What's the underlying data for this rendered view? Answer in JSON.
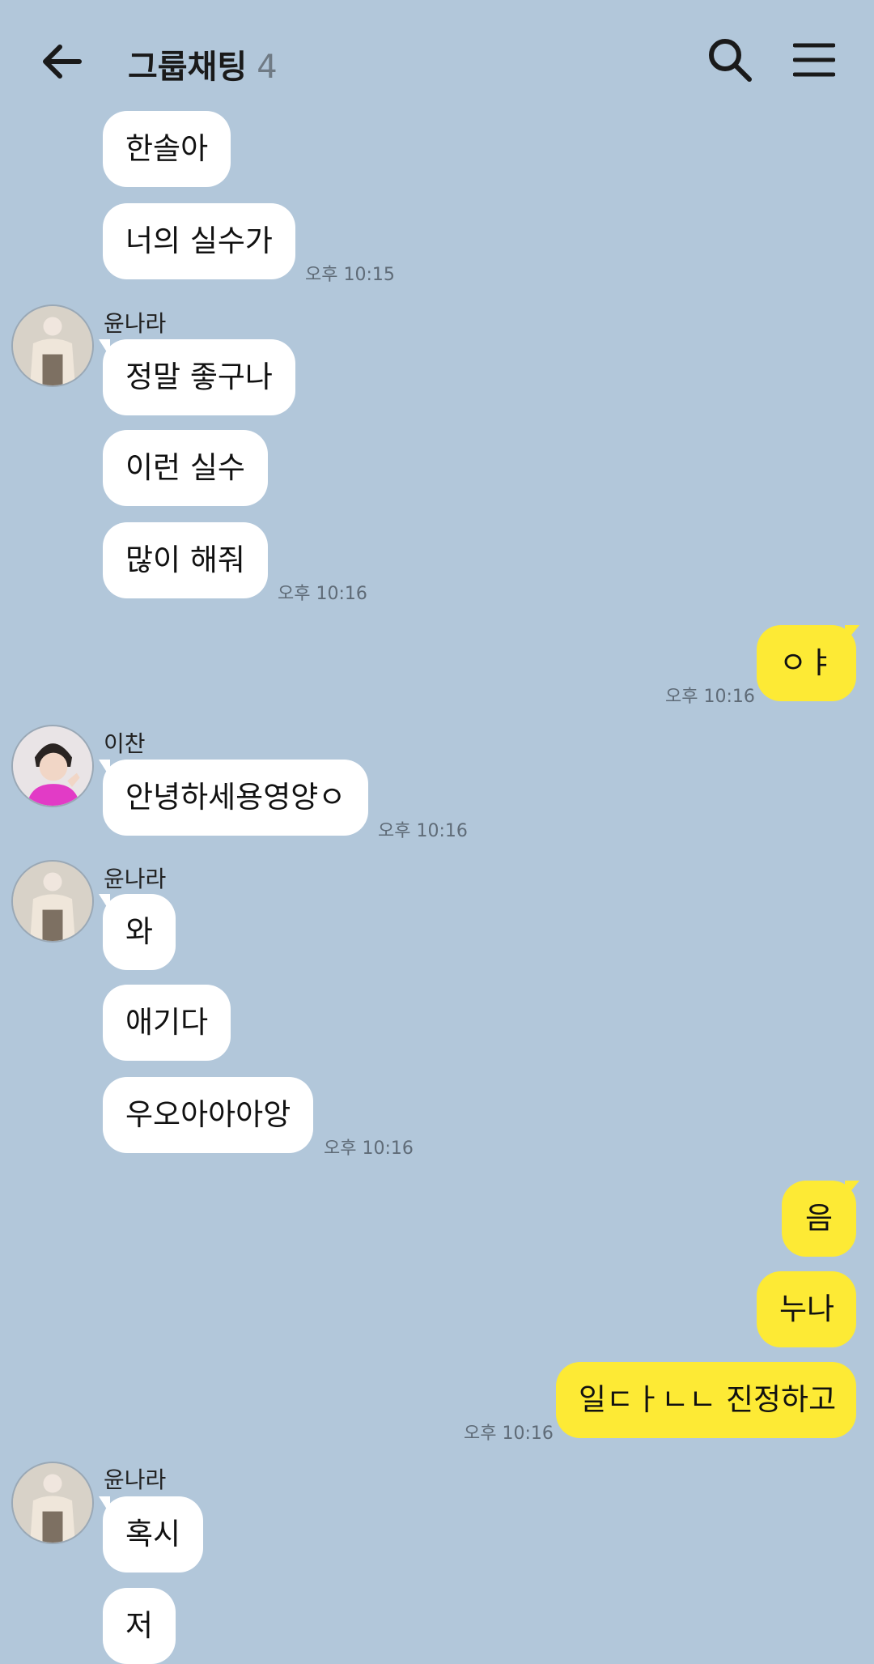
{
  "header": {
    "title": "그룹채팅",
    "member_count": "4",
    "back_icon": "arrow-left-icon",
    "search_icon": "search-icon",
    "menu_icon": "hamburger-menu-icon"
  },
  "colors": {
    "background": "#b2c7da",
    "incoming_bubble": "#ffffff",
    "outgoing_bubble": "#fdea35"
  },
  "messages": {
    "m1": "한솔아",
    "m2": "너의 실수가",
    "t1": "오후 10:15",
    "sender_yoonnara": "윤나라",
    "m3": "정말 좋구나",
    "m4": "이런 실수",
    "m5": "많이 해줘",
    "t2": "오후 10:16",
    "o1": "ㅇㅑ",
    "t3": "오후 10:16",
    "sender_ichan": "이찬",
    "m6": "안녕하세용영양ㅇ",
    "t4": "오후 10:16",
    "m7": "와",
    "m8": "애기다",
    "m9": "우오아아아앙",
    "t5": "오후 10:16",
    "o2": "음",
    "o3": "누나",
    "o4": "일ㄷㅏㄴㄴ 진정하고",
    "t6": "오후 10:16",
    "m10": "혹시",
    "m11": "저"
  }
}
